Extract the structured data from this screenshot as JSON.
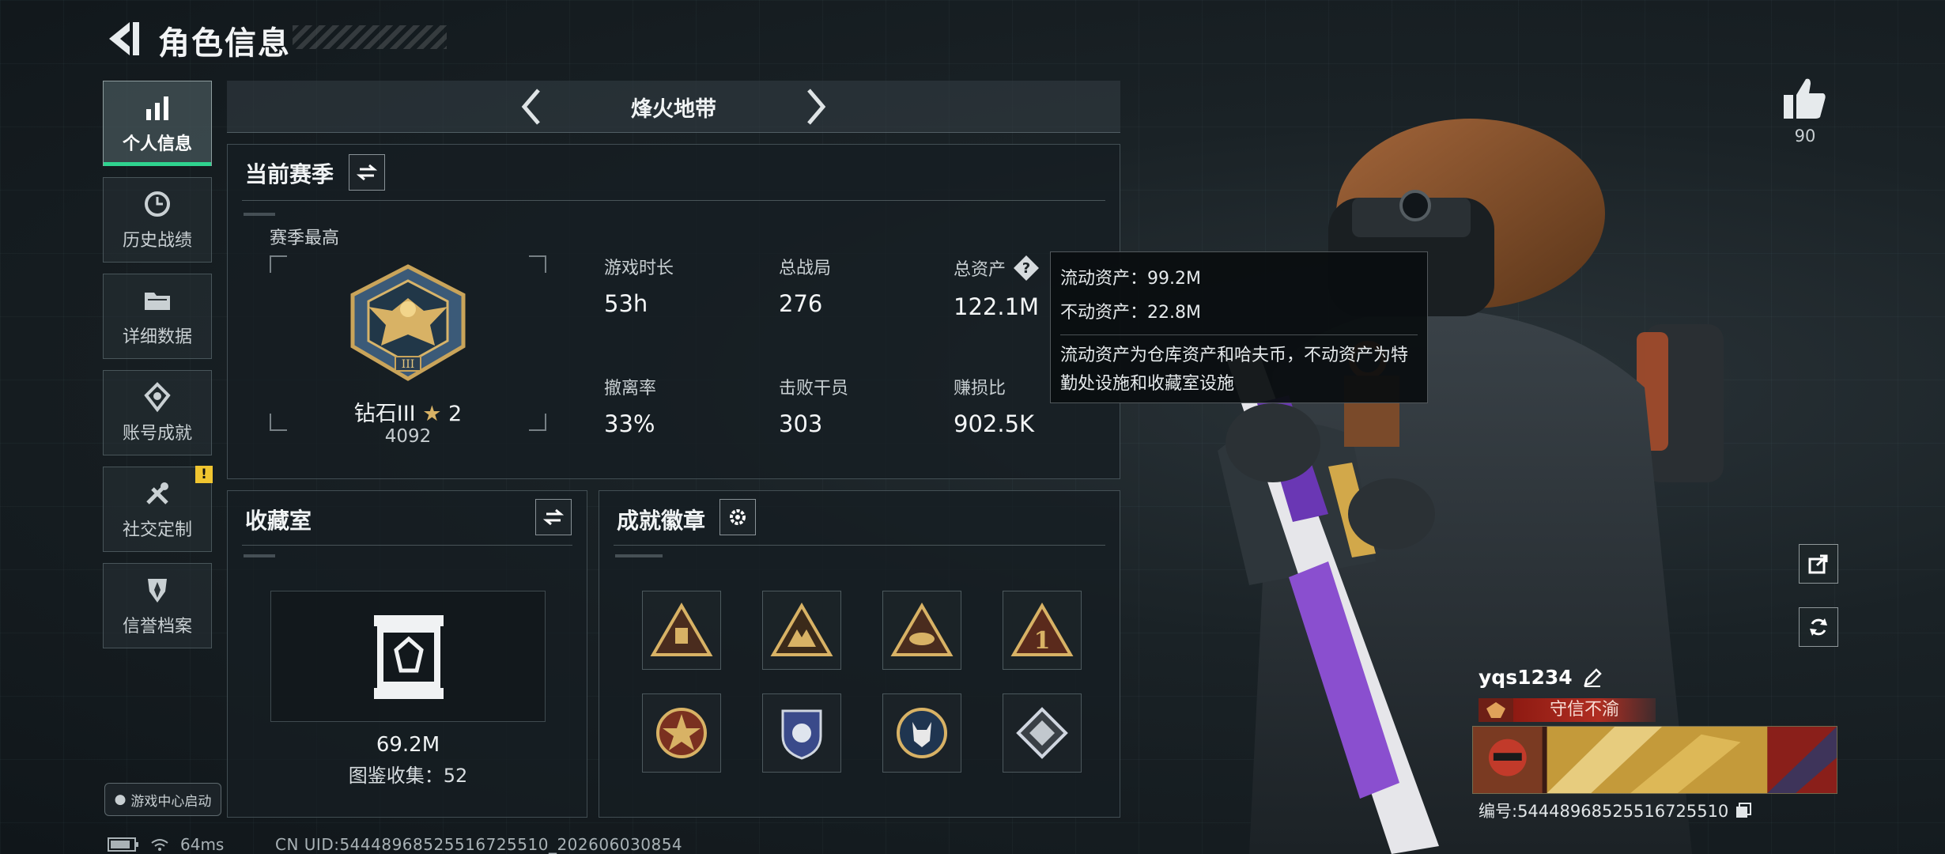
{
  "header": {
    "title": "角色信息"
  },
  "nav": {
    "items": [
      {
        "label": "个人信息",
        "active": true,
        "icon": "bar-chart-icon"
      },
      {
        "label": "历史战绩",
        "icon": "history-icon"
      },
      {
        "label": "详细数据",
        "icon": "folder-icon"
      },
      {
        "label": "账号成就",
        "icon": "achievement-icon"
      },
      {
        "label": "社交定制",
        "icon": "tools-icon",
        "badge": "!"
      },
      {
        "label": "信誉档案",
        "icon": "shield-icon"
      }
    ]
  },
  "mode": {
    "name": "烽火地带"
  },
  "season": {
    "title": "当前赛季",
    "best_label": "赛季最高",
    "rank_name": "钻石III",
    "rank_stars": "2",
    "rank_score": "4092",
    "stats": [
      {
        "label": "游戏时长",
        "value": "53h"
      },
      {
        "label": "总战局",
        "value": "276"
      },
      {
        "label": "总资产",
        "value": "122.1M"
      },
      {
        "label": "撤离率",
        "value": "33%"
      },
      {
        "label": "击败干员",
        "value": "303"
      },
      {
        "label": "赚损比",
        "value": "902.5K"
      }
    ]
  },
  "tooltip": {
    "line1": "流动资产：99.2M",
    "line2": "不动资产：22.8M",
    "desc": "流动资产为仓库资产和哈夫币，不动资产为特勤处设施和收藏室设施"
  },
  "collection": {
    "title": "收藏室",
    "value": "69.2M",
    "catalog": "图鉴收集：52"
  },
  "badges": {
    "title": "成就徽章",
    "items": [
      "triangle-badge-1",
      "triangle-badge-2",
      "triangle-badge-3",
      "triangle-badge-4",
      "star-medal",
      "shield-medal",
      "wolf-medal",
      "diamond-medal"
    ]
  },
  "footer": {
    "game_center": "游戏中心启动",
    "ping": "64ms",
    "uid": "CN UID:5444896852551672551​0_202606030854"
  },
  "side": {
    "likes": "90"
  },
  "player": {
    "name": "yqs1234",
    "title": "守信不渝",
    "id_line": "编号:5444896852551672551​0"
  },
  "colors": {
    "accent": "#2fd38f",
    "badge_yellow": "#f0c530",
    "title_red": "#b02e22",
    "gold": "#d8b265"
  }
}
